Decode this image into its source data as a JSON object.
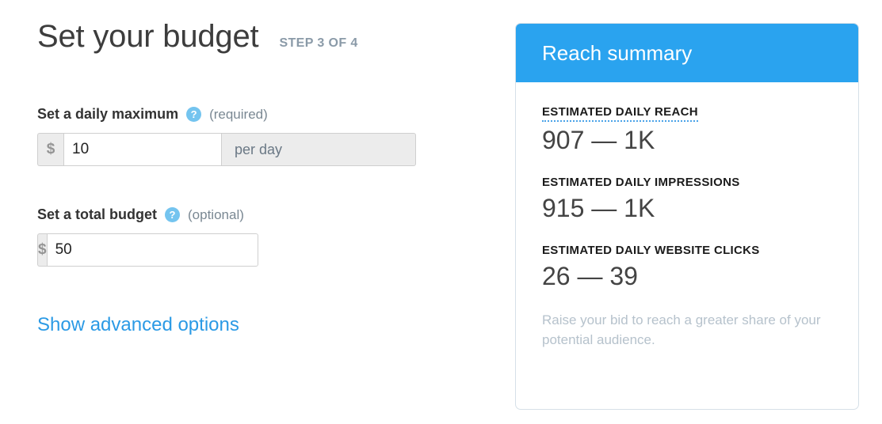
{
  "page": {
    "title": "Set your budget",
    "step_label": "STEP 3 OF 4"
  },
  "form": {
    "daily_max": {
      "label": "Set a daily maximum",
      "help_icon": "question-mark-icon",
      "help_glyph": "?",
      "requirement": "(required)",
      "currency_symbol": "$",
      "value": "10",
      "placeholder": "",
      "suffix": "per day"
    },
    "total_budget": {
      "label": "Set a total budget",
      "help_icon": "question-mark-icon",
      "help_glyph": "?",
      "requirement": "(optional)",
      "currency_symbol": "$",
      "value": "50",
      "placeholder": ""
    },
    "advanced_link": "Show advanced options"
  },
  "reach_summary": {
    "header": "Reach summary",
    "stats": [
      {
        "label": "ESTIMATED DAILY REACH",
        "value": "907 — 1K",
        "hinted": true
      },
      {
        "label": "ESTIMATED DAILY IMPRESSIONS",
        "value": "915 — 1K",
        "hinted": false
      },
      {
        "label": "ESTIMATED DAILY WEBSITE CLICKS",
        "value": "26 — 39",
        "hinted": false
      }
    ],
    "note": "Raise your bid to reach a greater share of your potential audience."
  },
  "colors": {
    "accent_blue": "#2aa3ef",
    "link_blue": "#2b9ae5",
    "help_icon_blue": "#74c4ef",
    "muted_text": "#7a8893",
    "note_text": "#b6c2cc",
    "card_border": "#d6e0e8",
    "addon_bg": "#ececec"
  }
}
